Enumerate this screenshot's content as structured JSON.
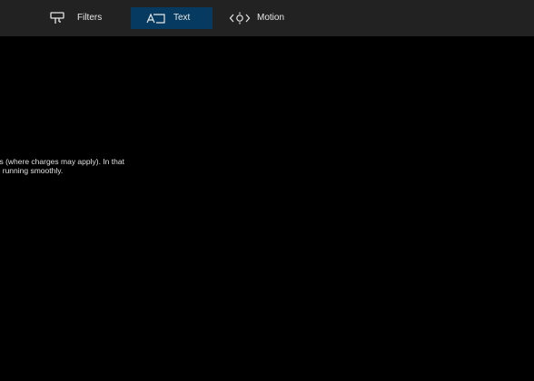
{
  "toolbar": {
    "tabs": [
      {
        "id": "filters",
        "label": "Filters",
        "icon": "filters-icon"
      },
      {
        "id": "text",
        "label": "Text",
        "icon": "text-icon",
        "selected": true
      },
      {
        "id": "motion",
        "label": "Motion",
        "icon": "motion-icon"
      }
    ]
  },
  "content": {
    "message_lines": [
      "ons (where charges may apply). In that",
      "ws running smoothly."
    ]
  },
  "colors": {
    "toolbar_bg": "#222222",
    "active_tab_bg": "#063a60",
    "canvas_bg": "#000000",
    "text": "#e6e6e6"
  }
}
